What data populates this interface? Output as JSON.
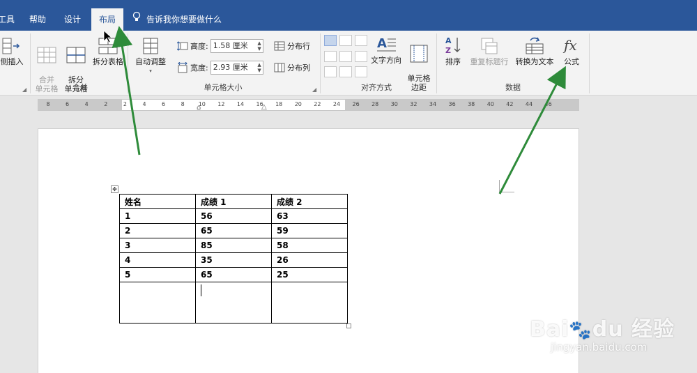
{
  "tabs": [
    {
      "label": "工具",
      "active": false
    },
    {
      "label": "帮助",
      "active": false
    },
    {
      "label": "设计",
      "active": false
    },
    {
      "label": "布局",
      "active": true
    }
  ],
  "tell_me": "告诉我你想要做什么",
  "ribbon": {
    "rows_cols": {
      "insert_right": "侧插入"
    },
    "merge": {
      "group_label": "合并",
      "merge_cells": "合并\n单元格",
      "split_cells": "拆分\n单元格",
      "split_table": "拆分表格"
    },
    "cell_size": {
      "group_label": "单元格大小",
      "autofit": "自动调整",
      "height_label": "高度:",
      "height_value": "1.58 厘米",
      "width_label": "宽度:",
      "width_value": "2.93 厘米",
      "distribute_rows": "分布行",
      "distribute_cols": "分布列"
    },
    "alignment": {
      "group_label": "对齐方式",
      "text_direction": "文字方向",
      "cell_margins": "单元格\n边距"
    },
    "data": {
      "group_label": "数据",
      "sort": "排序",
      "repeat_header": "重复标题行",
      "convert_to_text": "转换为文本",
      "formula": "公式"
    }
  },
  "ruler_ticks": [
    "8",
    "6",
    "4",
    "2",
    "2",
    "4",
    "6",
    "8",
    "10",
    "12",
    "14",
    "16",
    "18",
    "20",
    "22",
    "24",
    "26",
    "28",
    "30",
    "32",
    "34",
    "36",
    "38",
    "40",
    "42",
    "44",
    "46"
  ],
  "table": {
    "header": [
      "姓名",
      "成绩 1",
      "成绩 2"
    ],
    "rows": [
      [
        "1",
        "56",
        "63"
      ],
      [
        "2",
        "65",
        "59"
      ],
      [
        "3",
        "85",
        "58"
      ],
      [
        "4",
        "35",
        "26"
      ],
      [
        "5",
        "65",
        "25"
      ],
      [
        "",
        "",
        ""
      ]
    ]
  },
  "watermark": {
    "brand": "Bai du 经验",
    "url": "jingyan.baidu.com"
  },
  "colors": {
    "ribbon_blue": "#2b579a",
    "arrow_green": "#2e8b3a"
  }
}
